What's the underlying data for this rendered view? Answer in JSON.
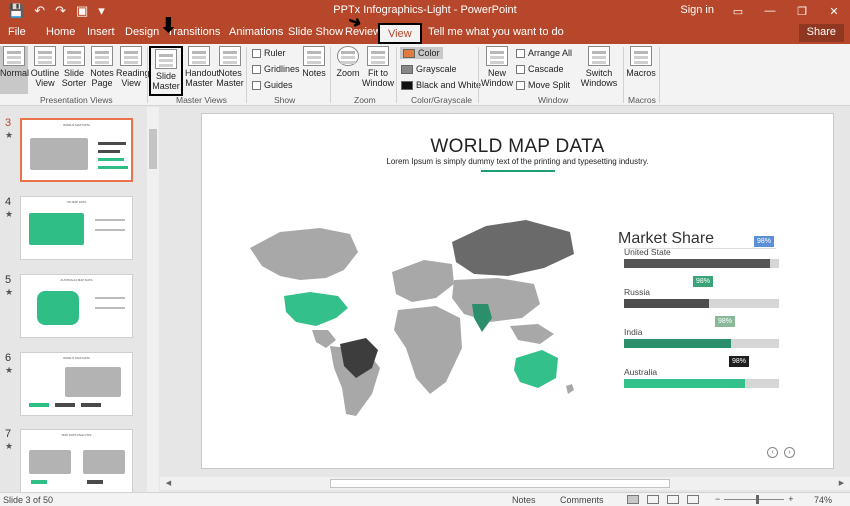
{
  "titlebar": {
    "title": "PPTx Infographics-Light  -  PowerPoint",
    "signin": "Sign in",
    "controls": {
      "ribbon_opts": "▭",
      "minimize": "—",
      "restore": "❐",
      "close": "✕"
    },
    "quick_access": {
      "save": "💾",
      "undo": "↶",
      "redo": "↷",
      "present": "▣",
      "more": "▾"
    }
  },
  "tabs": [
    "File",
    "Home",
    "Insert",
    "Design",
    "Transitions",
    "Animations",
    "Slide Show",
    "Review",
    "View"
  ],
  "tab_active": "View",
  "tell_me": "Tell me what you want to do",
  "share_label": "Share",
  "ribbon": {
    "presentation_views": {
      "label": "Presentation Views",
      "buttons": [
        "Normal",
        "Outline View",
        "Slide Sorter",
        "Notes Page",
        "Reading View"
      ]
    },
    "master_views": {
      "label": "Master Views",
      "buttons": [
        "Slide Master",
        "Handout Master",
        "Notes Master"
      ]
    },
    "show": {
      "label": "Show",
      "checks": [
        "Ruler",
        "Gridlines",
        "Guides"
      ],
      "notes_button": "Notes"
    },
    "zoom": {
      "label": "Zoom",
      "buttons": [
        "Zoom",
        "Fit to Window"
      ]
    },
    "color": {
      "label": "Color/Grayscale",
      "options": [
        "Color",
        "Grayscale",
        "Black and White"
      ]
    },
    "window": {
      "label": "Window",
      "new_window": "New Window",
      "options": [
        "Arrange All",
        "Cascade",
        "Move Split"
      ],
      "switch": "Switch Windows"
    },
    "macros": {
      "label": "Macros",
      "button": "Macros"
    }
  },
  "thumbnails": [
    {
      "num": "3",
      "star": "★",
      "title": "WORLD MAP DATA",
      "active": true
    },
    {
      "num": "4",
      "star": "★",
      "title": "US MAP DATA",
      "active": false
    },
    {
      "num": "5",
      "star": "★",
      "title": "AUSTRALIA MAP DATA",
      "active": false
    },
    {
      "num": "6",
      "star": "★",
      "title": "WORLD MAP DATA",
      "active": false
    },
    {
      "num": "7",
      "star": "★",
      "title": "MAP DATA ANALYSIS",
      "active": false
    }
  ],
  "slide": {
    "title": "WORLD MAP DATA",
    "subtitle": "Lorem Ipsum is simply dummy text of the printing and typesetting industry.",
    "market_title": "Market Share",
    "bars": [
      {
        "label": "United State",
        "value": 0.94,
        "badge": "98%",
        "color": "#555555",
        "badge_color": "#5b8fd6"
      },
      {
        "label": "Russia",
        "value": 0.55,
        "badge": "98%",
        "color": "#4d4d4d",
        "badge_color": "#3aa37a"
      },
      {
        "label": "India",
        "value": 0.69,
        "badge": "98%",
        "color": "#2a8f6a",
        "badge_color": "#8ab99a"
      },
      {
        "label": "Australia",
        "value": 0.78,
        "badge": "98%",
        "color": "#34c08a",
        "badge_color": "#1e1e1e"
      }
    ],
    "nav_prev": "‹",
    "nav_next": "›"
  },
  "status": {
    "slide_info": "Slide 3 of 50",
    "notes": "Notes",
    "comments": "Comments",
    "zoom_minus": "−",
    "zoom_plus": "+",
    "zoom": "74%"
  },
  "colors": {
    "accent": "#b7472a",
    "green": "#34c08a",
    "dark_green": "#1f9e73",
    "map_gray": "#a8a8a8",
    "map_dark": "#3d3d3d"
  }
}
